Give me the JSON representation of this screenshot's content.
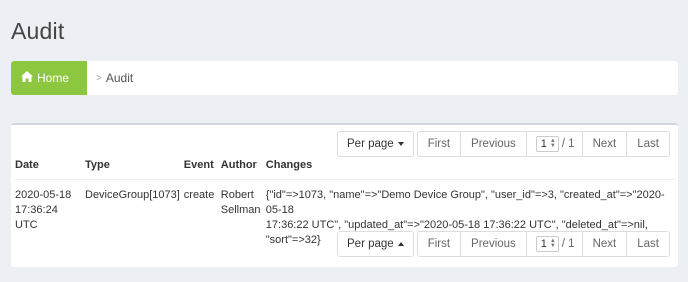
{
  "page": {
    "title": "Audit"
  },
  "breadcrumb": {
    "home": "Home",
    "separator": ">",
    "current": "Audit"
  },
  "pager": {
    "per_page": "Per page",
    "first": "First",
    "previous": "Previous",
    "page_value": "1",
    "total": "/ 1",
    "next": "Next",
    "last": "Last"
  },
  "table": {
    "headers": {
      "date": "Date",
      "type": "Type",
      "event": "Event",
      "author": "Author",
      "changes": "Changes"
    },
    "rows": [
      {
        "date_line1": "2020-05-18",
        "date_line2": "17:36:24 UTC",
        "type": "DeviceGroup[1073]",
        "event": "create",
        "author_line1": "Robert",
        "author_line2": "Sellman",
        "changes_line1": "{\"id\"=>1073, \"name\"=>\"Demo Device Group\", \"user_id\"=>3, \"created_at\"=>\"2020-05-18",
        "changes_line2": "17:36:22 UTC\", \"updated_at\"=>\"2020-05-18 17:36:22 UTC\", \"deleted_at\"=>nil, \"sort\"=>32}"
      }
    ]
  },
  "colors": {
    "accent": "#8dc63f",
    "background": "#ecf0f5"
  },
  "icons": {
    "home": "home-icon"
  }
}
